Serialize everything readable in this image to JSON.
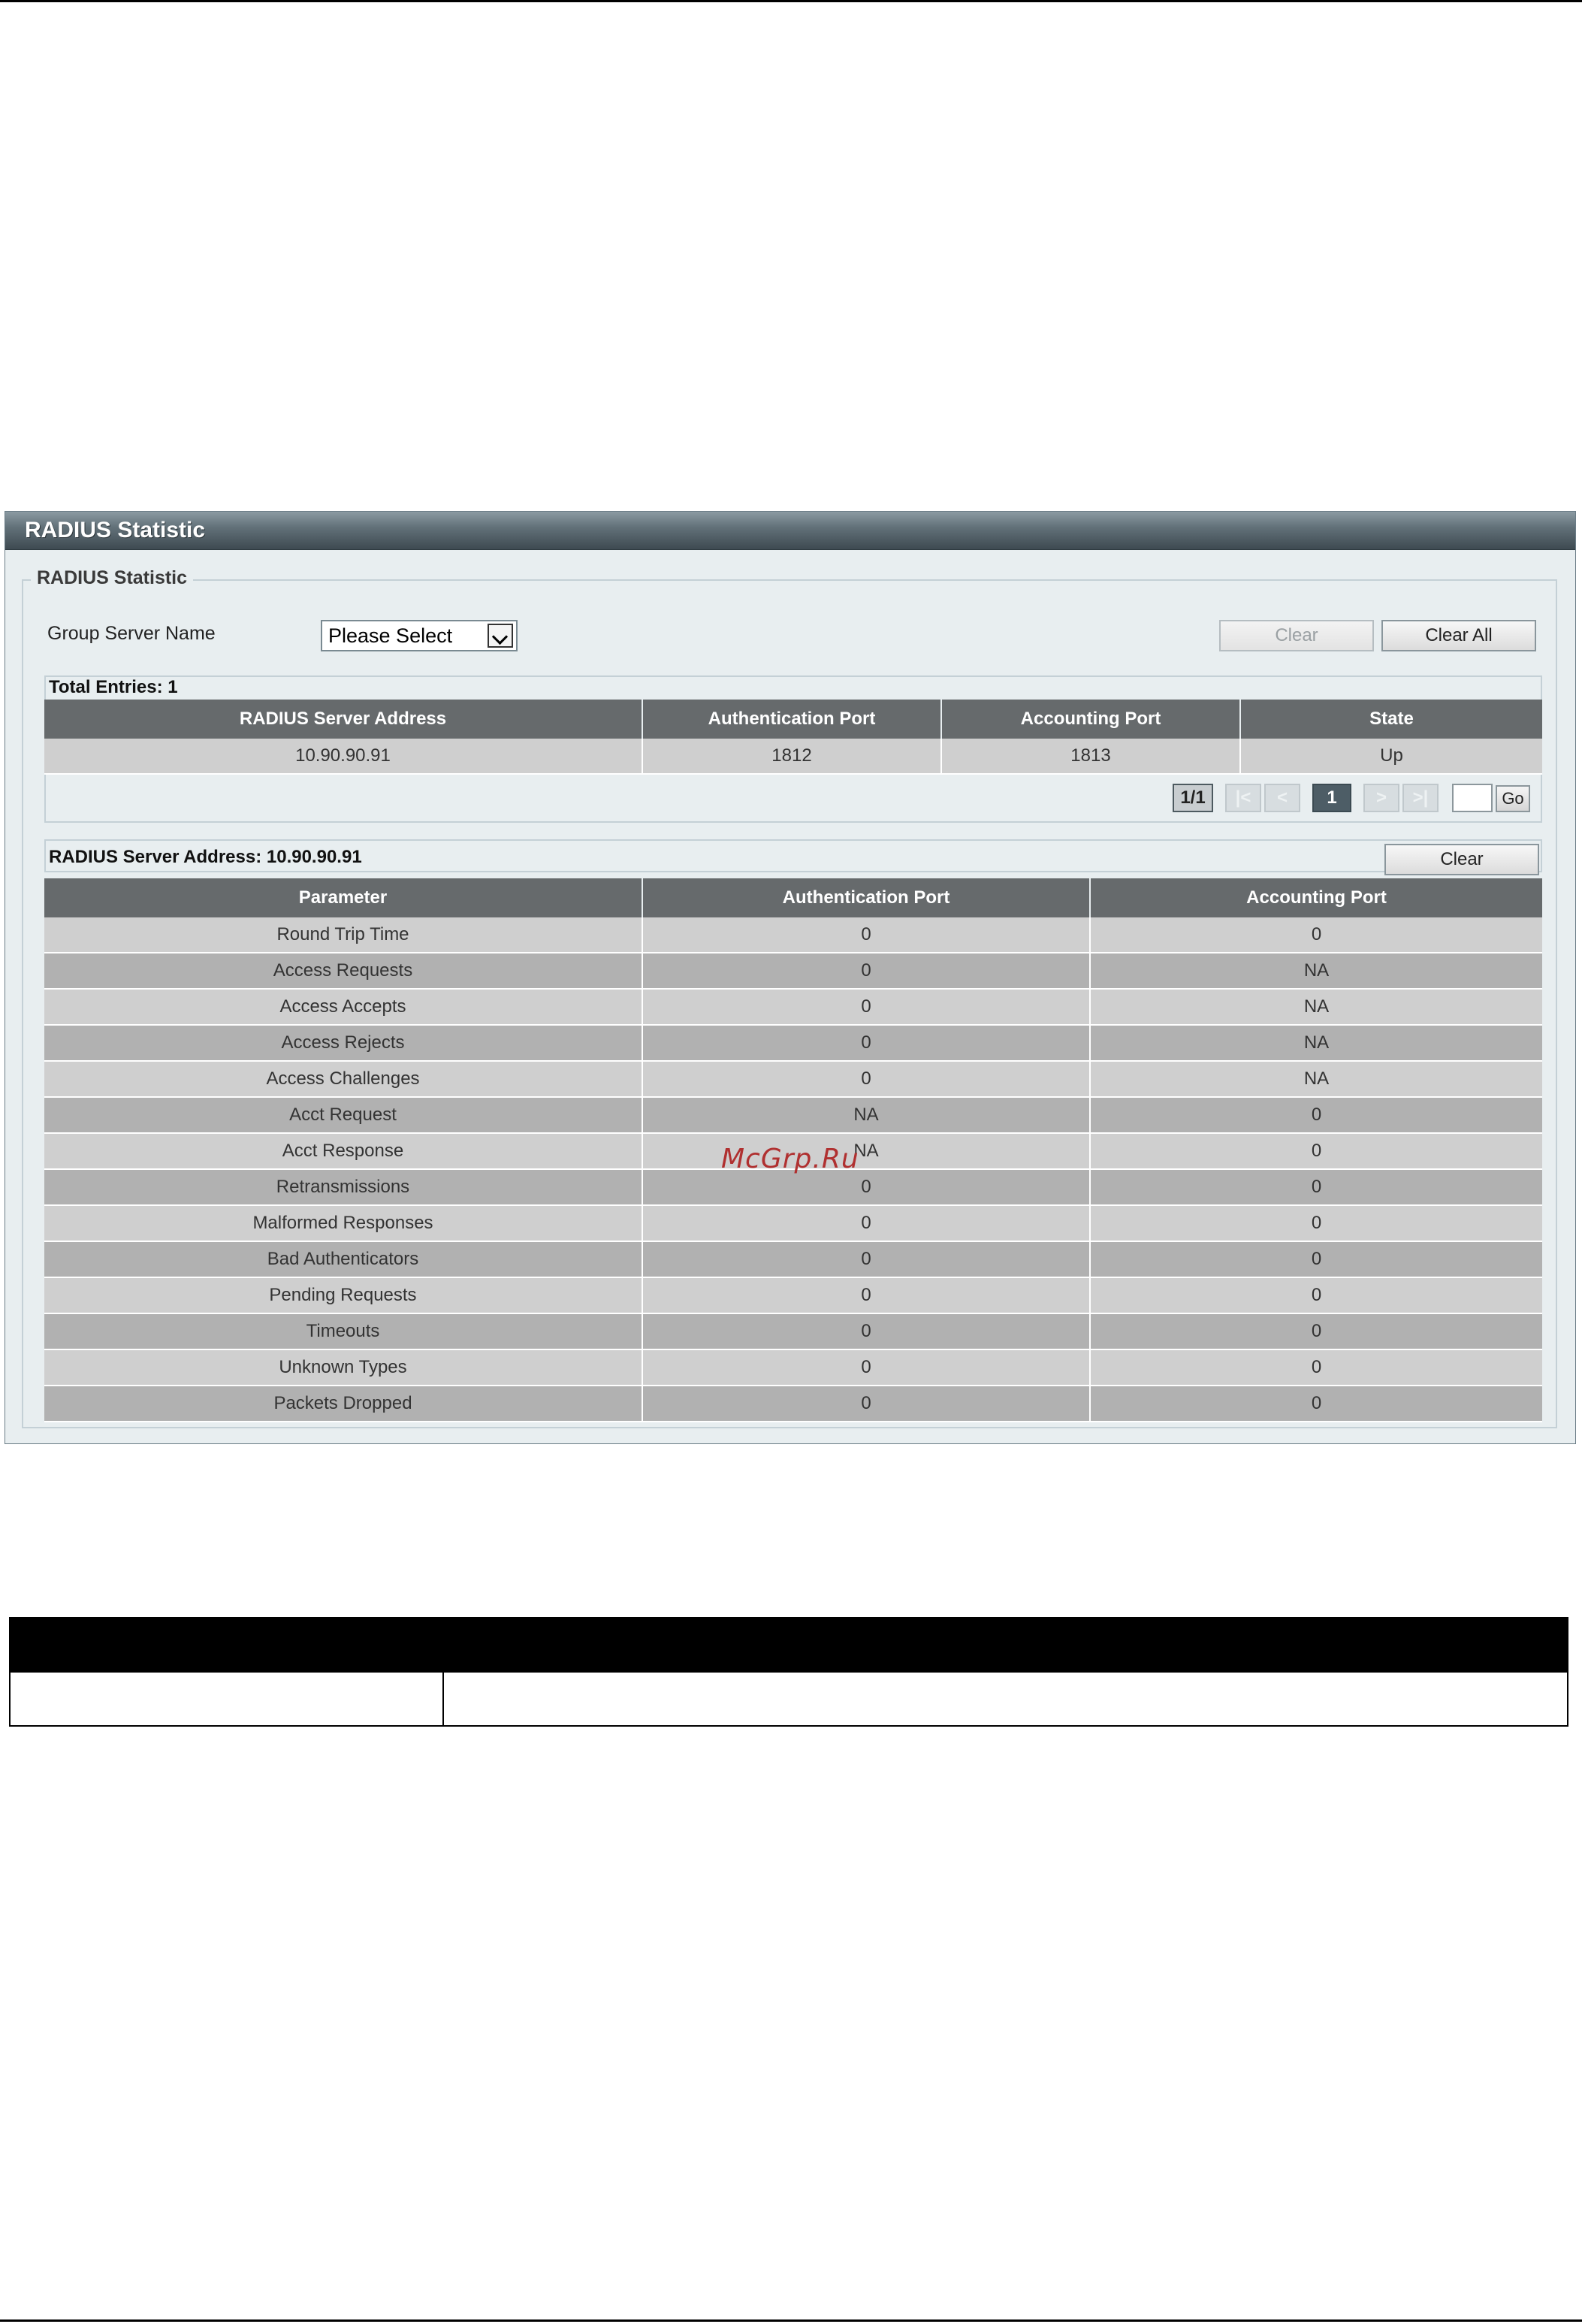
{
  "panel": {
    "title": "RADIUS Statistic",
    "legend": "RADIUS Statistic",
    "group_server_label": "Group Server Name",
    "group_server_select": "Please Select",
    "clear_label": "Clear",
    "clear_all_label": "Clear All"
  },
  "servers": {
    "total_entries": "Total Entries: 1",
    "columns": [
      "RADIUS Server Address",
      "Authentication Port",
      "Accounting Port",
      "State"
    ],
    "rows": [
      [
        "10.90.90.91",
        "1812",
        "1813",
        "Up"
      ]
    ]
  },
  "pagination": {
    "page_info": "1/1",
    "first": "|<",
    "prev": "<",
    "current": "1",
    "next": ">",
    "last": ">|",
    "go_label": "Go"
  },
  "stats": {
    "title": "RADIUS Server Address: 10.90.90.91",
    "clear_label": "Clear",
    "columns": [
      "Parameter",
      "Authentication Port",
      "Accounting Port"
    ],
    "rows": [
      [
        "Round Trip Time",
        "0",
        "0"
      ],
      [
        "Access Requests",
        "0",
        "NA"
      ],
      [
        "Access Accepts",
        "0",
        "NA"
      ],
      [
        "Access Rejects",
        "0",
        "NA"
      ],
      [
        "Access Challenges",
        "0",
        "NA"
      ],
      [
        "Acct Request",
        "NA",
        "0"
      ],
      [
        "Acct Response",
        "NA",
        "0"
      ],
      [
        "Retransmissions",
        "0",
        "0"
      ],
      [
        "Malformed Responses",
        "0",
        "0"
      ],
      [
        "Bad Authenticators",
        "0",
        "0"
      ],
      [
        "Pending Requests",
        "0",
        "0"
      ],
      [
        "Timeouts",
        "0",
        "0"
      ],
      [
        "Unknown Types",
        "0",
        "0"
      ],
      [
        "Packets Dropped",
        "0",
        "0"
      ]
    ]
  },
  "watermark": "McGrp.Ru",
  "colors": {
    "header_bg": "#666a6c",
    "row_light": "#cfcfcf",
    "row_dark": "#b1b1b1",
    "panel_bg": "#e8eef0",
    "watermark": "#b03030"
  }
}
